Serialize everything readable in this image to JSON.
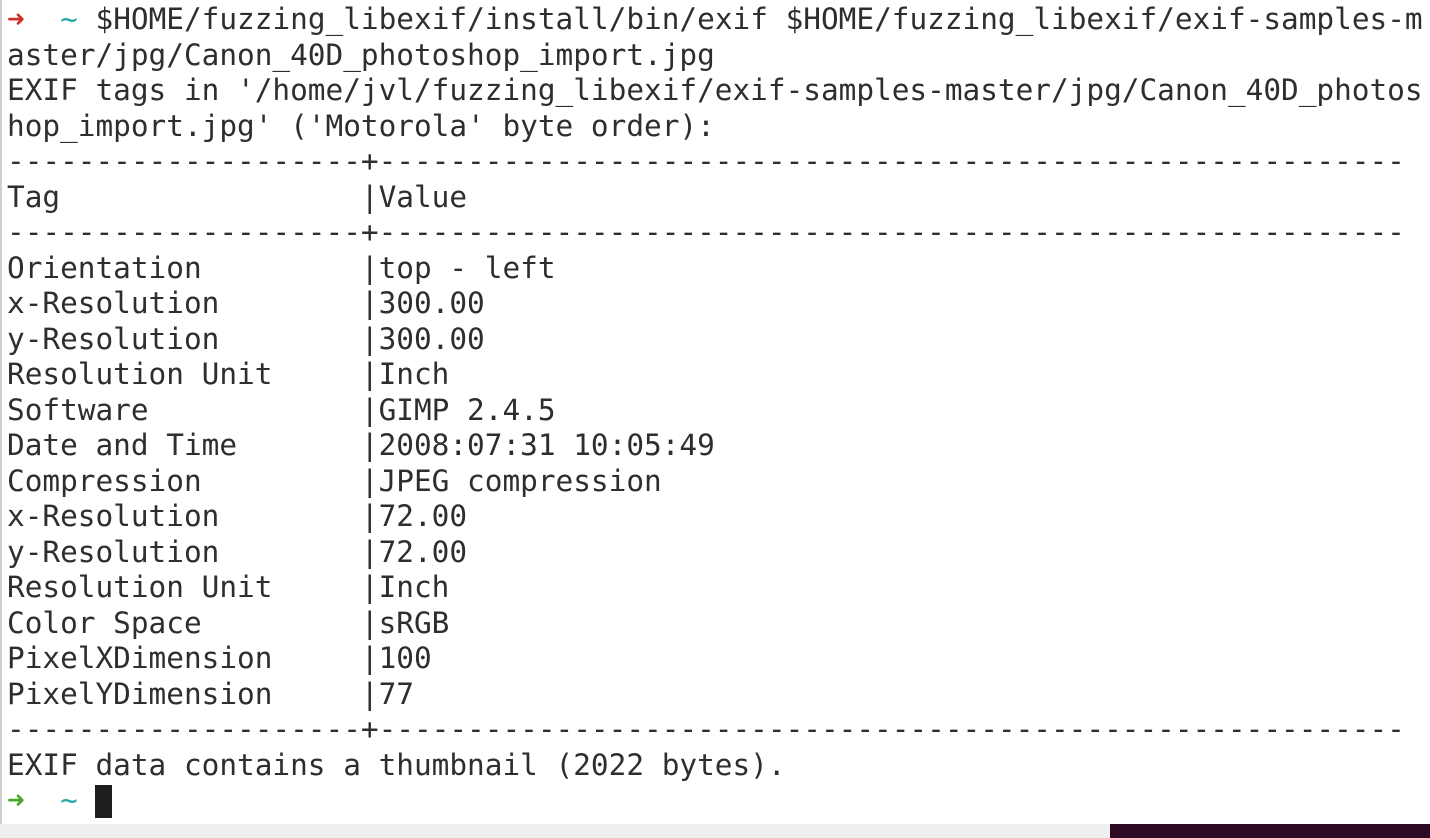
{
  "terminal": {
    "prompt_symbol": "➜",
    "prompt_dir": "~",
    "colors": {
      "prompt_error": "#d0302a",
      "prompt_ok": "#45a829",
      "dir": "#2aa8a8",
      "text": "#2e2e2e",
      "cursor": "#1e1e1e"
    },
    "command_line_1": "$HOME/fuzzing_libexif/install/bin/exif $HOME/fuzzing_libexif/exif-samples-m",
    "command_line_2": "aster/jpg/Canon_40D_photoshop_import.jpg",
    "output": [
      "EXIF tags in '/home/jvl/fuzzing_libexif/exif-samples-master/jpg/Canon_40D_photos",
      "hop_import.jpg' ('Motorola' byte order):",
      "--------------------+----------------------------------------------------------",
      "Tag                 |Value",
      "--------------------+----------------------------------------------------------",
      "Orientation         |top - left",
      "x-Resolution        |300.00",
      "y-Resolution        |300.00",
      "Resolution Unit     |Inch",
      "Software            |GIMP 2.4.5",
      "Date and Time       |2008:07:31 10:05:49",
      "Compression         |JPEG compression",
      "x-Resolution        |72.00",
      "y-Resolution        |72.00",
      "Resolution Unit     |Inch",
      "Color Space         |sRGB",
      "PixelXDimension     |100",
      "PixelYDimension     |77",
      "--------------------+----------------------------------------------------------",
      "EXIF data contains a thumbnail (2022 bytes)."
    ]
  }
}
